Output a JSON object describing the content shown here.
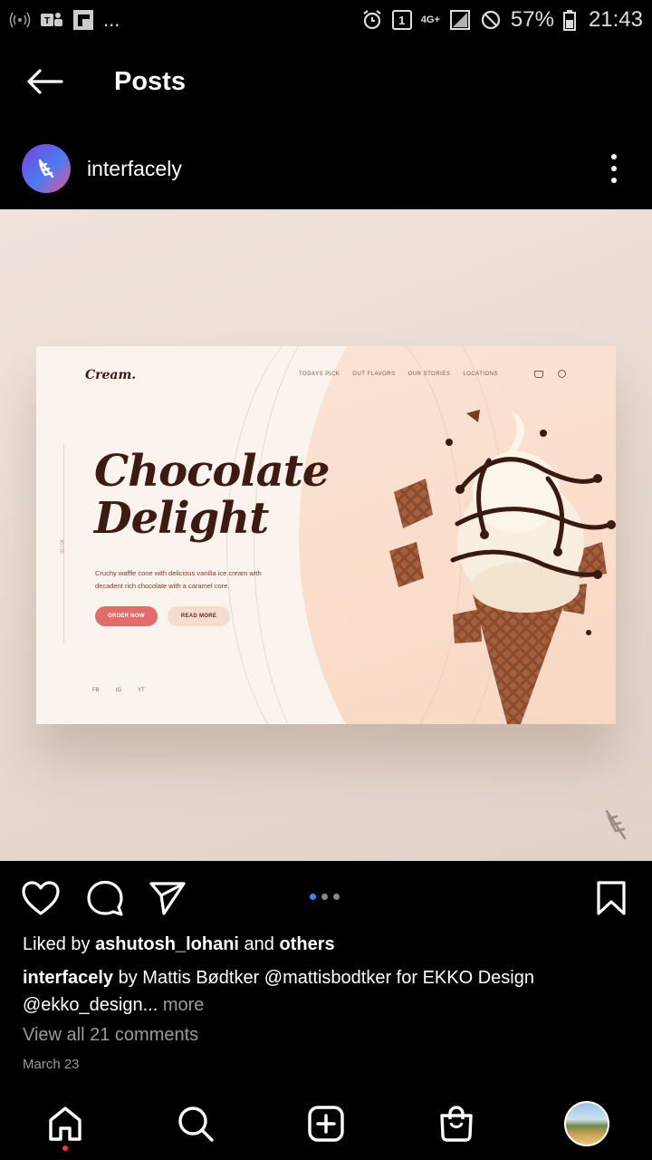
{
  "status_bar": {
    "network_label": "4G+",
    "battery": "57%",
    "time": "21:43",
    "notification_dots": "...",
    "sim_badge": "1",
    "icons": [
      "wireless-signal-icon",
      "teams-icon",
      "flipboard-icon",
      "alarm-icon",
      "sim-icon",
      "signal-icon",
      "dnd-icon",
      "battery-icon"
    ]
  },
  "header": {
    "title": "Posts",
    "back_icon": "arrow-left-icon"
  },
  "account": {
    "username": "interfacely",
    "more_icon": "more-vertical-icon"
  },
  "post_image": {
    "logo": "Cream.",
    "nav": [
      "TODAYS PICK",
      "OUT FLAVORS",
      "OUR STORIES",
      "LOCATIONS"
    ],
    "side_index": "02 / 04",
    "title_line1": "Chocolate",
    "title_line2": "Delight",
    "description": "Cruchy waffle cone with delicious vanilla ice cream with decadent rich chocolate with a caramel core.",
    "order_button": "ORDER NOW",
    "read_button": "READ MORE",
    "social": [
      "FB",
      "IG",
      "YT"
    ]
  },
  "carousel": {
    "count": 3,
    "active_index": 0
  },
  "likes": {
    "prefix": "Liked by",
    "user": "ashutosh_lohani",
    "middle": "and",
    "others": "others"
  },
  "caption": {
    "username": "interfacely",
    "text": "by Mattis Bødtker @mattisbodtker for EKKO Design @ekko_design...",
    "more": " more"
  },
  "comments_link": "View all 21 comments",
  "date": "March 23",
  "colors": {
    "accent_blue": "#2f8bff",
    "notification_red": "#ff3040",
    "order_button": "#e56b6b"
  }
}
